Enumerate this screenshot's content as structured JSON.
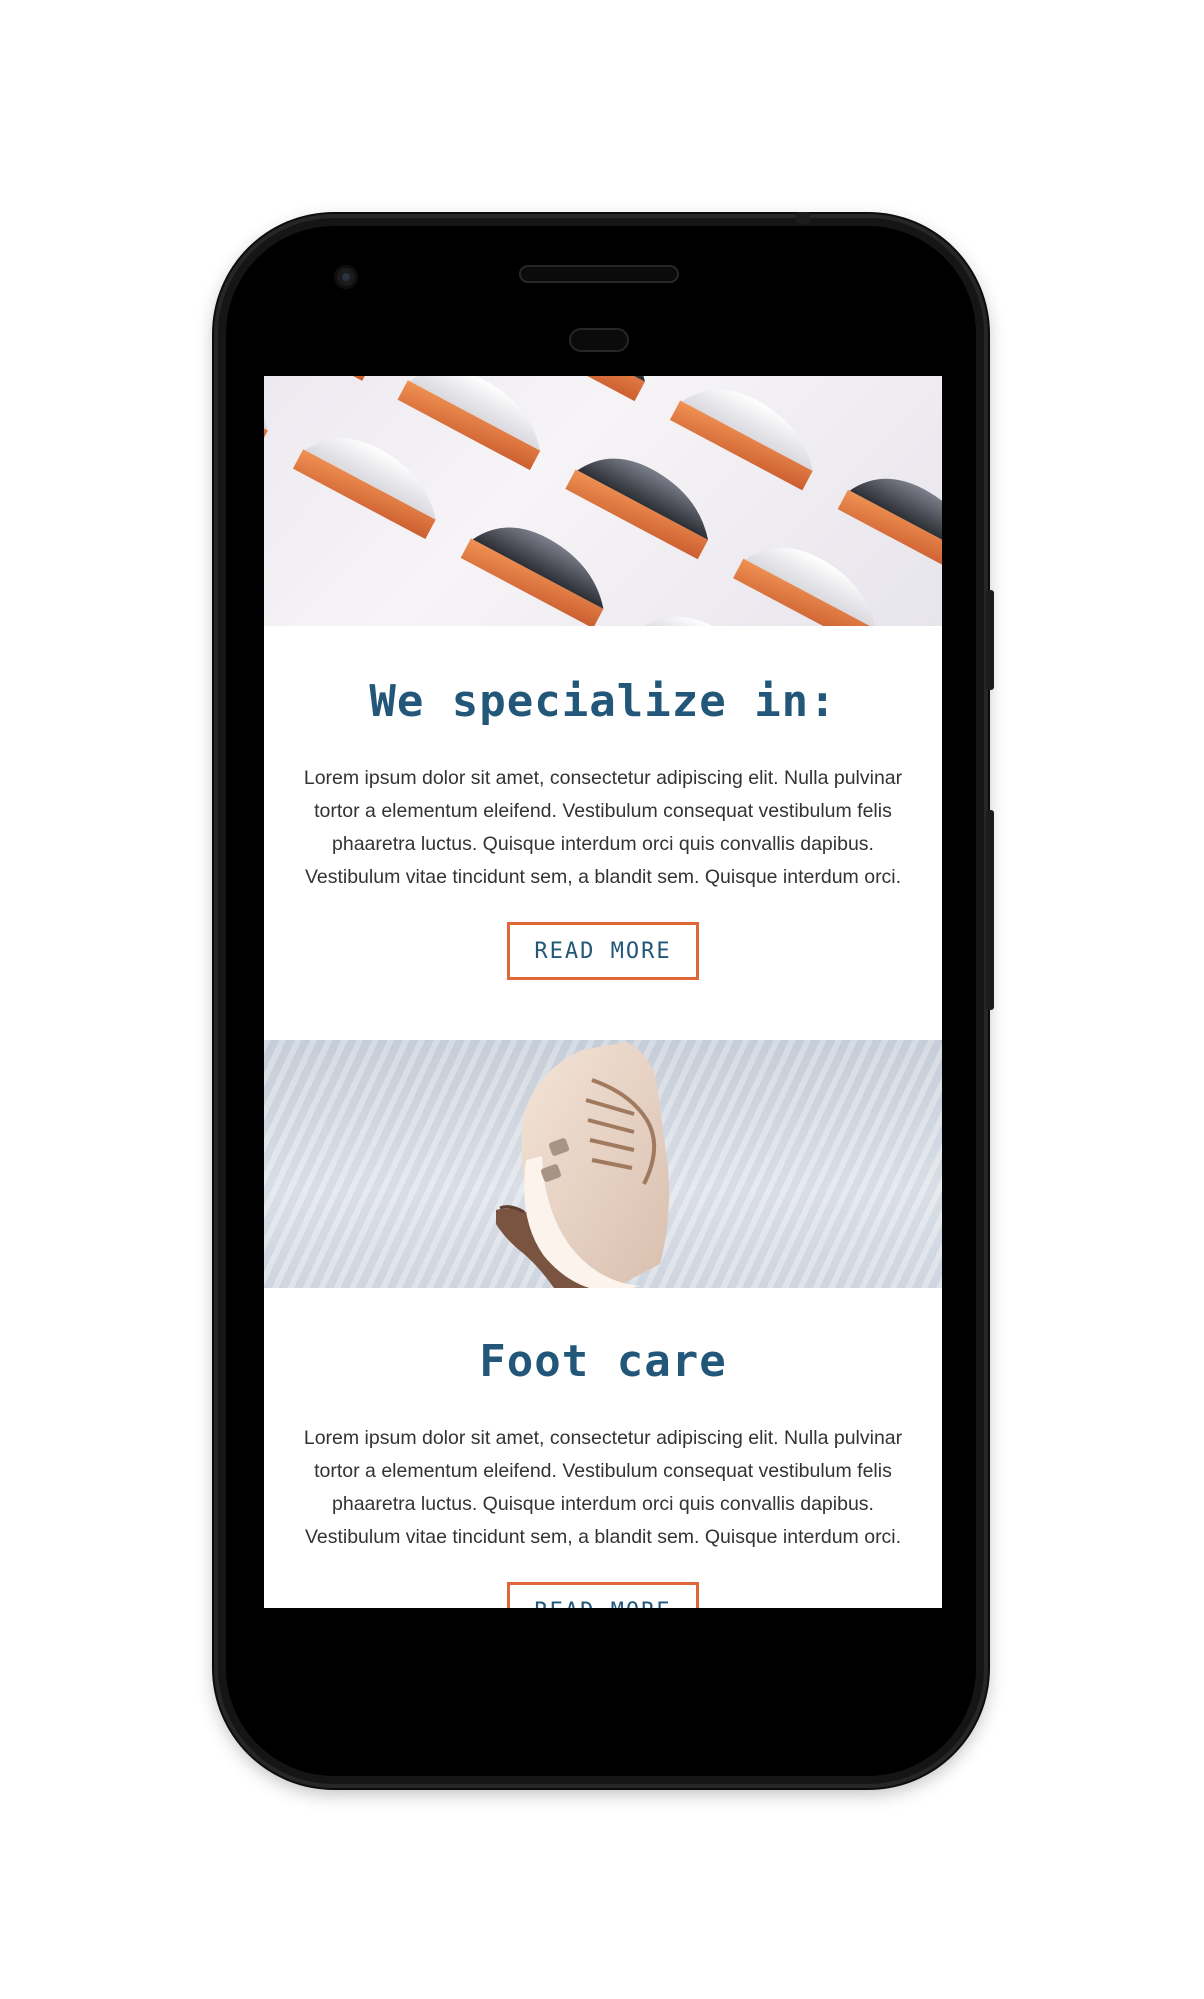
{
  "screen": {
    "sections": [
      {
        "title": "We specialize in:",
        "text": "Lorem ipsum dolor sit amet, consectetur adipiscing elit. Nulla pulvinar tortor a elementum eleifend. Vestibulum consequat vestibulum felis phaaretra luctus. Quisque interdum orci quis convallis dapibus. Vestibulum vitae tincidunt sem, a blandit sem. Quisque interdum orci.",
        "button_label": "READ MORE"
      },
      {
        "title": "Foot care",
        "text": "Lorem ipsum dolor sit amet, consectetur adipiscing elit. Nulla pulvinar tortor a elementum eleifend. Vestibulum consequat vestibulum felis phaaretra luctus. Quisque interdum orci quis convallis dapibus. Vestibulum vitae tincidunt sem, a blandit sem. Quisque interdum orci.",
        "button_label": "READ MORE"
      }
    ]
  },
  "colors": {
    "heading": "#22577a",
    "button_border": "#e0673a",
    "body_text": "#333333"
  }
}
